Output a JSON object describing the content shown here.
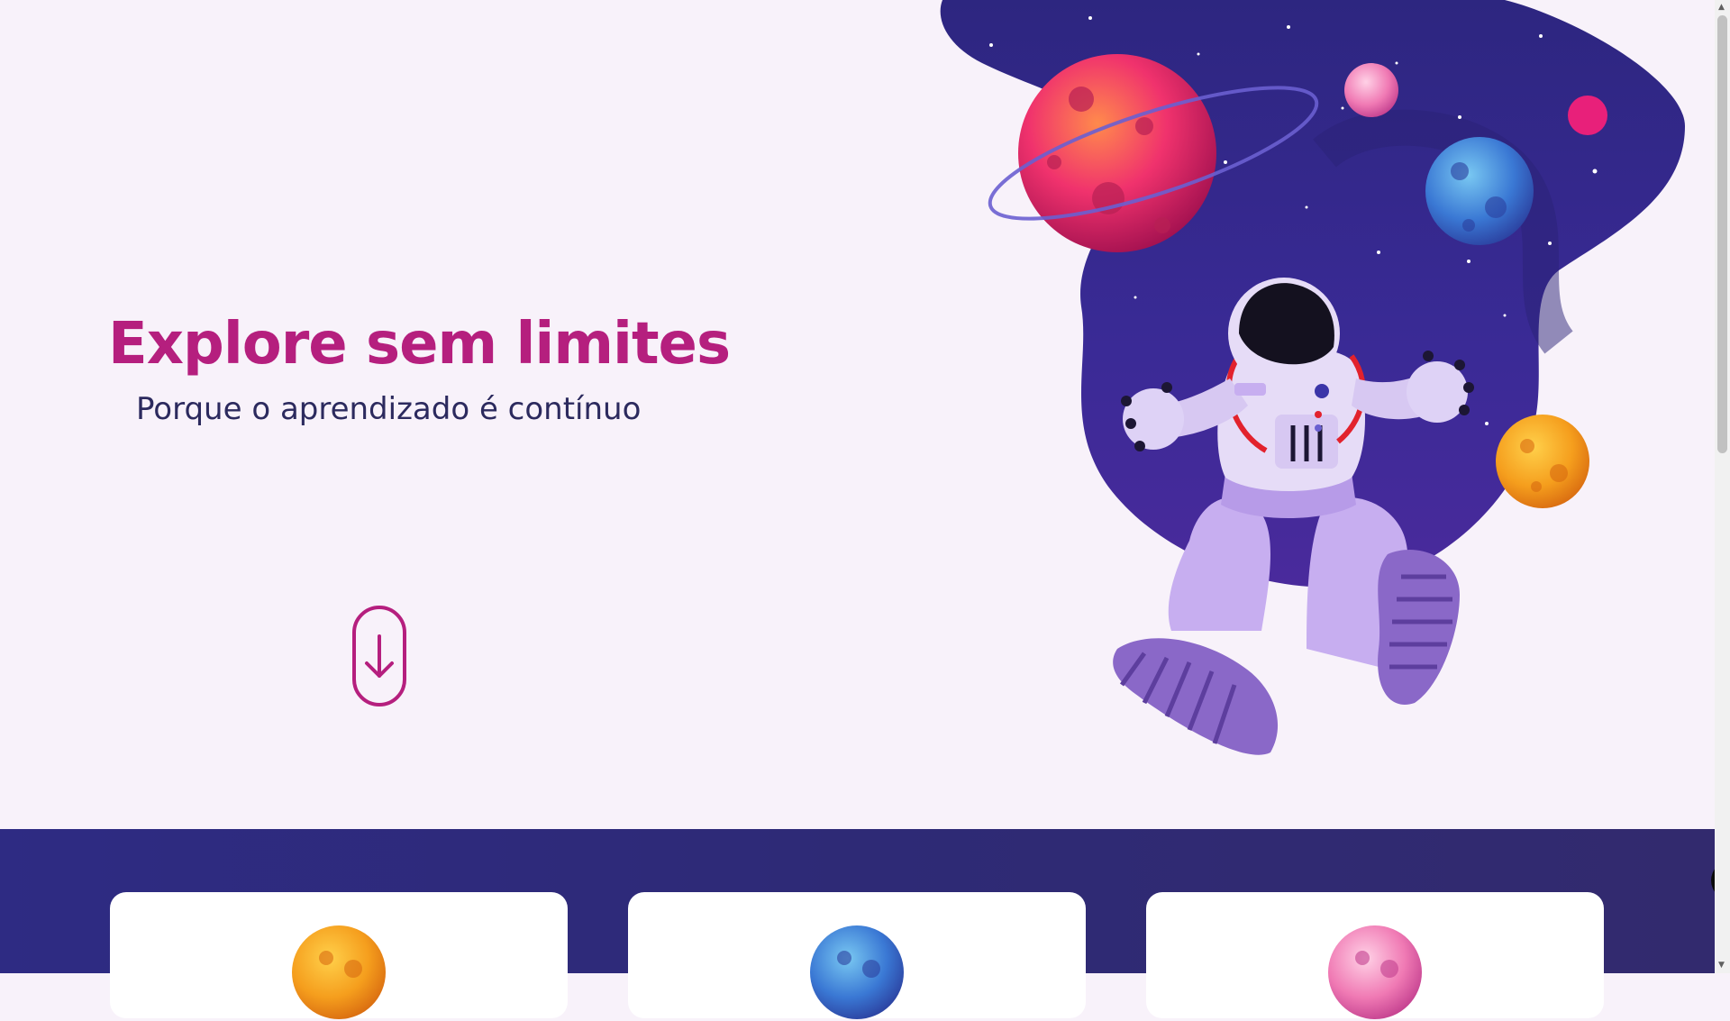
{
  "hero": {
    "title": "Explore sem limites",
    "subtitle": "Porque o aprendizado é contínuo"
  },
  "icons": {
    "scroll_down": "arrow-down-icon",
    "side_tab": "chevron-left-icon"
  },
  "cards": [
    {
      "planet": "orange-planet-icon"
    },
    {
      "planet": "blue-planet-icon"
    },
    {
      "planet": "pink-planet-icon"
    }
  ],
  "colors": {
    "accent": "#b51f7e",
    "text_dark": "#2c2a5e",
    "page_bg": "#f8f2fa",
    "band_bg": "#2e2b83"
  }
}
